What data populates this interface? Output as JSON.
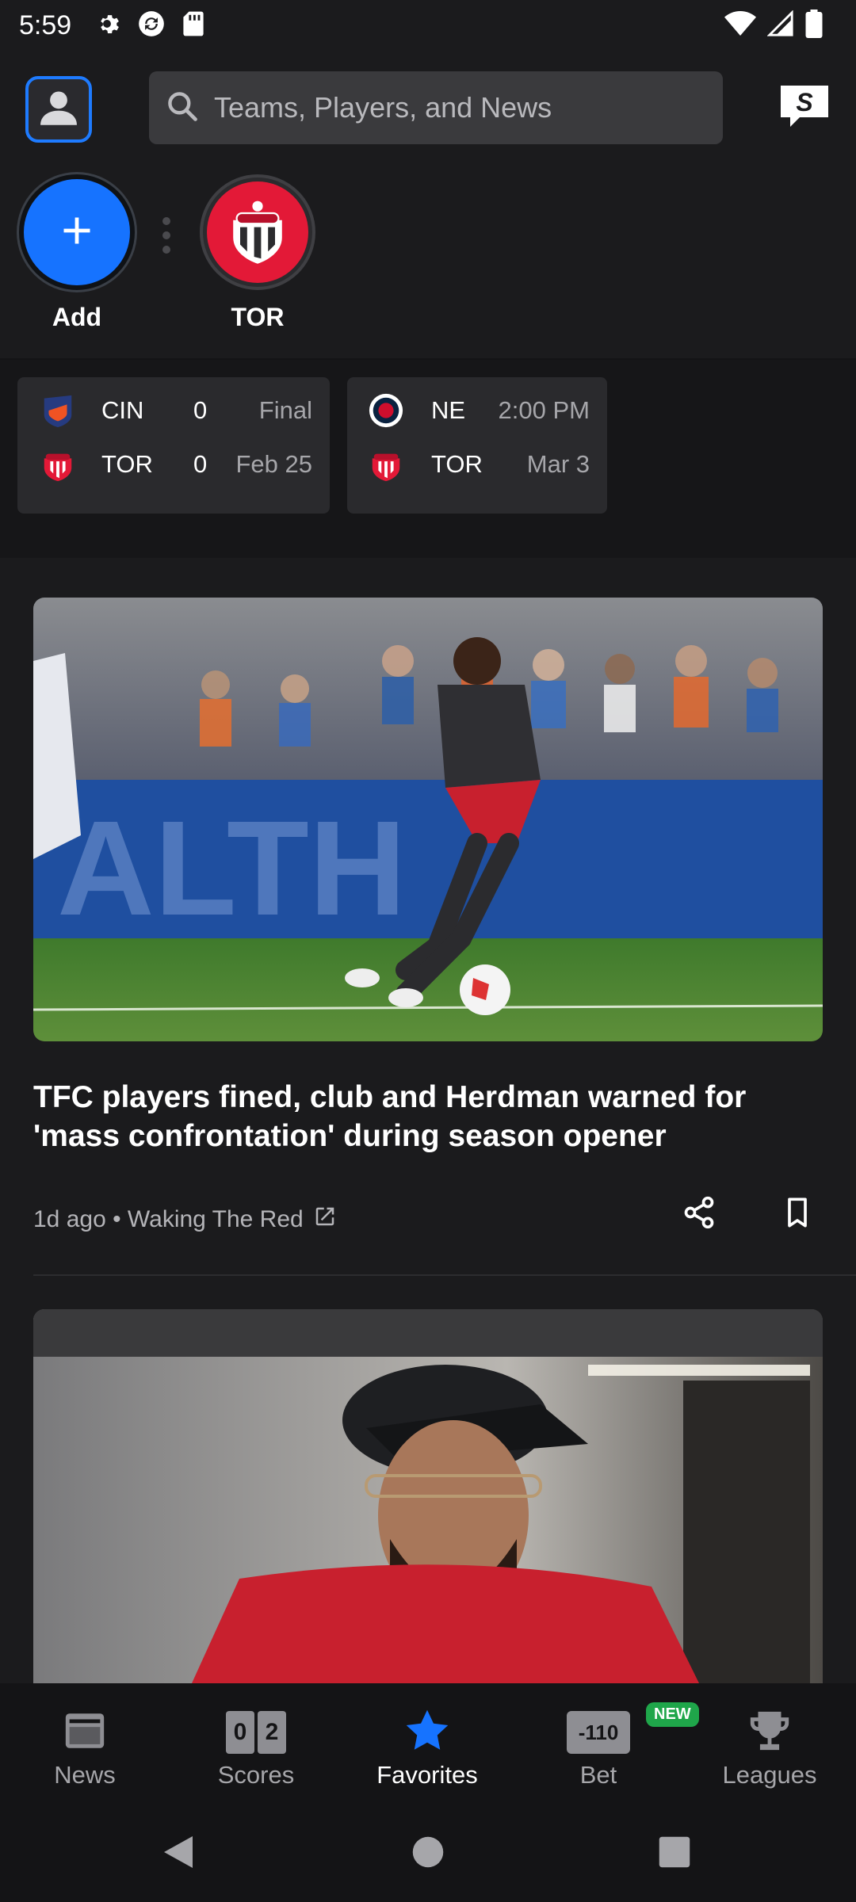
{
  "status_bar": {
    "time": "5:59"
  },
  "header": {
    "search_placeholder": "Teams, Players, and News"
  },
  "favorites": {
    "add_label": "Add",
    "teams": [
      {
        "label": "TOR"
      }
    ]
  },
  "scores": [
    {
      "rows": [
        {
          "team": "CIN",
          "score": "0",
          "status": "Final"
        },
        {
          "team": "TOR",
          "score": "0",
          "status": "Feb 25"
        }
      ]
    },
    {
      "rows": [
        {
          "team": "NE",
          "status": "2:00 PM"
        },
        {
          "team": "TOR",
          "status": "Mar 3"
        }
      ]
    }
  ],
  "articles": [
    {
      "title": "TFC players fined, club and Herdman warned for 'mass confrontation' during season opener",
      "meta": "1d ago • Waking The Red"
    }
  ],
  "bottom_nav": {
    "items": [
      {
        "label": "News"
      },
      {
        "label": "Scores",
        "icon_text_left": "0",
        "icon_text_right": "2"
      },
      {
        "label": "Favorites"
      },
      {
        "label": "Bet",
        "badge": "NEW",
        "icon_text": "-110"
      },
      {
        "label": "Leagues"
      }
    ],
    "active": "Favorites"
  },
  "colors": {
    "accent": "#1673ff",
    "tor_red": "#e31937",
    "badge_green": "#1fa64a",
    "background": "#1b1b1d"
  }
}
